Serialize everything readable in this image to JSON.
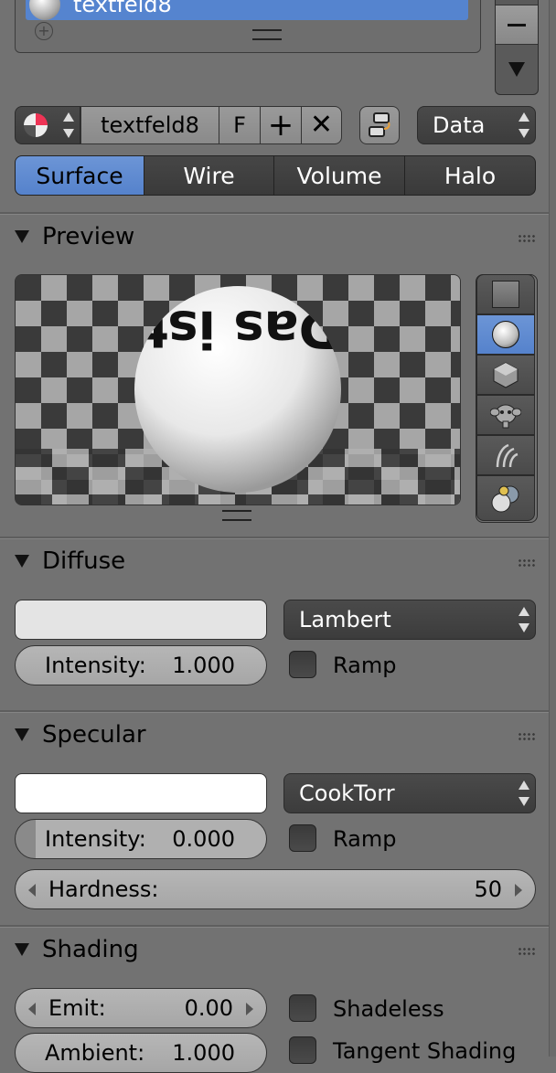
{
  "slot_list": {
    "active_item": "textfeld8"
  },
  "material_selector": {
    "name": "textfeld8",
    "fake_user_label": "F",
    "link_mode": "Data"
  },
  "tabs": [
    {
      "label": "Surface",
      "active": true
    },
    {
      "label": "Wire",
      "active": false
    },
    {
      "label": "Volume",
      "active": false
    },
    {
      "label": "Halo",
      "active": false
    }
  ],
  "preview": {
    "title": "Preview",
    "sphere_text": "Das ist Texte",
    "shapes": [
      "flat-icon",
      "sphere-icon",
      "cube-icon",
      "monkey-icon",
      "hair-icon",
      "sphere-sky-icon"
    ],
    "active_shape": "sphere-icon"
  },
  "diffuse": {
    "title": "Diffuse",
    "color": "#e4e4e4",
    "shader": "Lambert",
    "intensity_label": "Intensity:",
    "intensity_value": "1.000",
    "ramp_label": "Ramp"
  },
  "specular": {
    "title": "Specular",
    "color": "#ffffff",
    "shader": "CookTorr",
    "intensity_label": "Intensity:",
    "intensity_value": "0.000",
    "ramp_label": "Ramp",
    "hardness_label": "Hardness:",
    "hardness_value": "50"
  },
  "shading": {
    "title": "Shading",
    "emit_label": "Emit:",
    "emit_value": "0.00",
    "ambient_label": "Ambient:",
    "ambient_value": "1.000",
    "shadeless_label": "Shadeless",
    "tangent_label": "Tangent Shading"
  }
}
